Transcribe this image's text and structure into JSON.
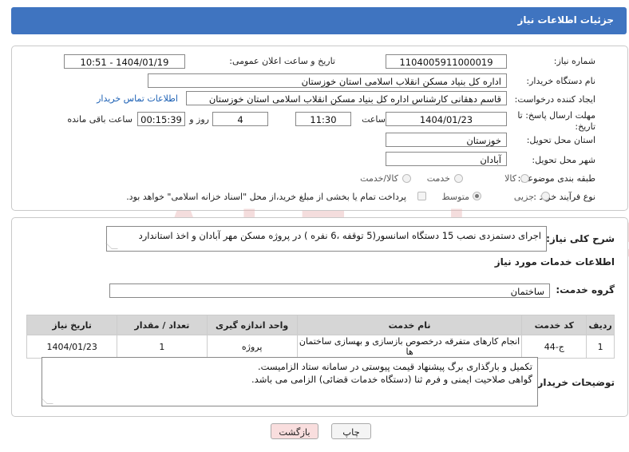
{
  "header": {
    "title": "جزئیات اطلاعات نیاز"
  },
  "fields": {
    "need_number_label": "شماره نیاز:",
    "need_number": "1104005911000019",
    "announce_label": "تاریخ و ساعت اعلان عمومی:",
    "announce_value": "1404/01/19 - 10:51",
    "buyer_org_label": "نام دستگاه خریدار:",
    "buyer_org": "اداره کل بنیاد مسکن انقلاب اسلامی استان خوزستان",
    "creator_label": "ایجاد کننده درخواست:",
    "creator": "قاسم دهقانی کارشناس اداره کل بنیاد مسکن انقلاب اسلامی استان خوزستان",
    "contact_link": "اطلاعات تماس خریدار",
    "deadline_label_line1": "مهلت ارسال پاسخ: تا",
    "deadline_label_line2": "تاریخ:",
    "deadline_date": "1404/01/23",
    "time_label": "ساعت",
    "deadline_time": "11:30",
    "days_value": "4",
    "days_label": "روز و",
    "remaining_time": "00:15:39",
    "remaining_label": "ساعت باقی مانده",
    "province_label": "استان محل تحویل:",
    "province": "خوزستان",
    "city_label": "شهر محل تحویل:",
    "city": "آبادان",
    "category_label": "طبقه بندی موضوعی:",
    "category_options": [
      "کالا",
      "خدمت",
      "کالا/خدمت"
    ],
    "process_label": "نوع فرآیند خرید :",
    "process_options": [
      "جزیی",
      "متوسط"
    ],
    "payment_note": "پرداخت تمام یا بخشی از مبلغ خرید،از محل \"اسناد خزانه اسلامی\" خواهد بود."
  },
  "summary": {
    "label": "شرح کلی نیاز:",
    "text": "اجرای دستمزدی نصب 15 دستگاه  اسانسور(5 توقفه ،6 نفره ) در  پروژه  مسکن مهر آبادان و اخذ استاندارد"
  },
  "services": {
    "section_title": "اطلاعات خدمات مورد نیاز",
    "group_label": "گروه خدمت:",
    "group_value": "ساختمان",
    "columns": [
      "ردیف",
      "کد خدمت",
      "نام خدمت",
      "واحد اندازه گیری",
      "تعداد / مقدار",
      "تاریخ نیاز"
    ],
    "rows": [
      [
        "1",
        "ج-44",
        "انجام کارهای متفرقه درخصوص بازسازی و بهسازی ساختمان ها",
        "پروژه",
        "1",
        "1404/01/23"
      ]
    ]
  },
  "buyer_notes": {
    "label": "توضیحات خریدار:",
    "line1": "تکمیل و بارگذاری برگ پیشنهاد قیمت پیوستی در سامانه ستاد الزامیست.",
    "line2": "گواهی صلاحیت ایمنی و فرم ثنا (دستگاه خدمات قضائی) الزامی می باشد."
  },
  "buttons": {
    "print": "چاپ",
    "back": "بازگشت"
  },
  "colors": {
    "header_bg": "#3f74c0",
    "link": "#1a5fb4",
    "back_btn_bg": "#f9dede"
  },
  "watermark": {
    "brand": "AriaTender.neT"
  }
}
